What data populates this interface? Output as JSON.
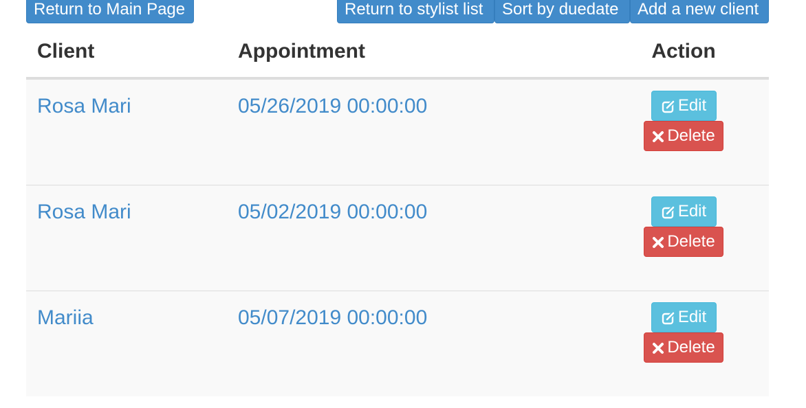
{
  "toolbar": {
    "main_page_label": "Return to Main Page",
    "stylist_list_label": "Return to stylist list",
    "sort_label": "Sort by duedate",
    "add_client_label": "Add a new client"
  },
  "table": {
    "headers": {
      "client": "Client",
      "appointment": "Appointment",
      "action": "Action"
    },
    "rows": [
      {
        "client": "Rosa Mari",
        "appointment": "05/26/2019 00:00:00",
        "edit_label": "Edit",
        "delete_label": "Delete"
      },
      {
        "client": "Rosa Mari",
        "appointment": "05/02/2019 00:00:00",
        "edit_label": "Edit",
        "delete_label": "Delete"
      },
      {
        "client": "Mariia",
        "appointment": "05/07/2019 00:00:00",
        "edit_label": "Edit",
        "delete_label": "Delete"
      }
    ]
  },
  "icons": {
    "edit": "edit-icon",
    "delete": "remove-icon"
  },
  "colors": {
    "primary": "#428bca",
    "info": "#5bc0de",
    "danger": "#d9534f",
    "row_background": "#f9f9f9"
  }
}
